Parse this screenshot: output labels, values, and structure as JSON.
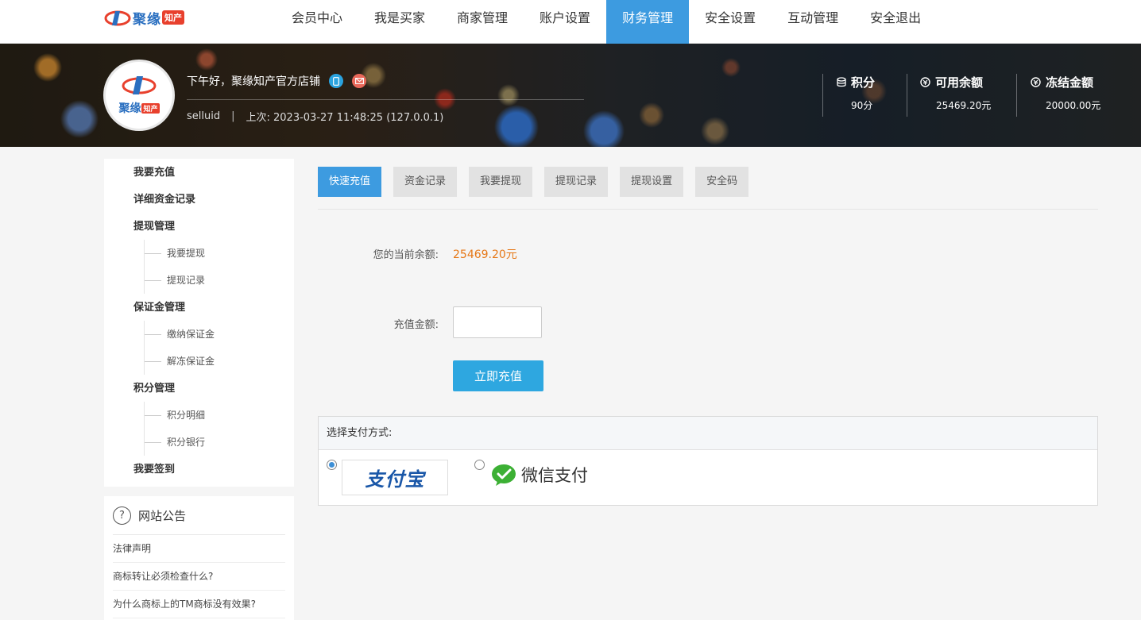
{
  "header": {
    "logo_text": "聚缘",
    "logo_tag": "知产",
    "nav": [
      {
        "label": "会员中心"
      },
      {
        "label": "我是买家"
      },
      {
        "label": "商家管理"
      },
      {
        "label": "账户设置"
      },
      {
        "label": "财务管理"
      },
      {
        "label": "安全设置"
      },
      {
        "label": "互动管理"
      },
      {
        "label": "安全退出"
      }
    ],
    "active_nav": "财务管理"
  },
  "banner": {
    "avatar_text": "聚缘",
    "avatar_tag": "知产",
    "greeting": "下午好，聚缘知产官方店铺",
    "username": "selluid",
    "separator": "|",
    "last_login": "上次: 2023-03-27 11:48:25 (127.0.0.1)",
    "stats": [
      {
        "title": "积分",
        "value": "90分"
      },
      {
        "title": "可用余额",
        "value": "25469.20元"
      },
      {
        "title": "冻结金额",
        "value": "20000.00元"
      }
    ]
  },
  "sidebar": {
    "items": [
      {
        "label": "我要充值",
        "level": 1
      },
      {
        "label": "详细资金记录",
        "level": 1
      },
      {
        "label": "提现管理",
        "level": 1
      },
      {
        "label": "我要提现",
        "level": 2
      },
      {
        "label": "提现记录",
        "level": 2
      },
      {
        "label": "保证金管理",
        "level": 1
      },
      {
        "label": "缴纳保证金",
        "level": 2
      },
      {
        "label": "解冻保证金",
        "level": 2
      },
      {
        "label": "积分管理",
        "level": 1
      },
      {
        "label": "积分明细",
        "level": 2
      },
      {
        "label": "积分银行",
        "level": 2
      },
      {
        "label": "我要签到",
        "level": 1
      }
    ]
  },
  "notice": {
    "title": "网站公告",
    "items": [
      {
        "label": "法律声明"
      },
      {
        "label": "商标转让必须检查什么?"
      },
      {
        "label": "为什么商标上的TM商标没有效果?"
      }
    ]
  },
  "main": {
    "tabs": [
      {
        "label": "快速充值"
      },
      {
        "label": "资金记录"
      },
      {
        "label": "我要提现"
      },
      {
        "label": "提现记录"
      },
      {
        "label": "提现设置"
      },
      {
        "label": "安全码"
      }
    ],
    "active_tab": "快速充值",
    "balance_label": "您的当前余额:",
    "balance_value": "25469.20元",
    "amount_label": "充值金额:",
    "amount_value": "",
    "submit_label": "立即充值",
    "payment_title": "选择支付方式:",
    "payment_options": [
      {
        "label": "支付宝",
        "selected": true
      },
      {
        "label": "微信支付",
        "selected": false
      }
    ]
  },
  "colors": {
    "accent": "#3d9be0",
    "button": "#2ea7e0",
    "balance": "#e67817"
  }
}
